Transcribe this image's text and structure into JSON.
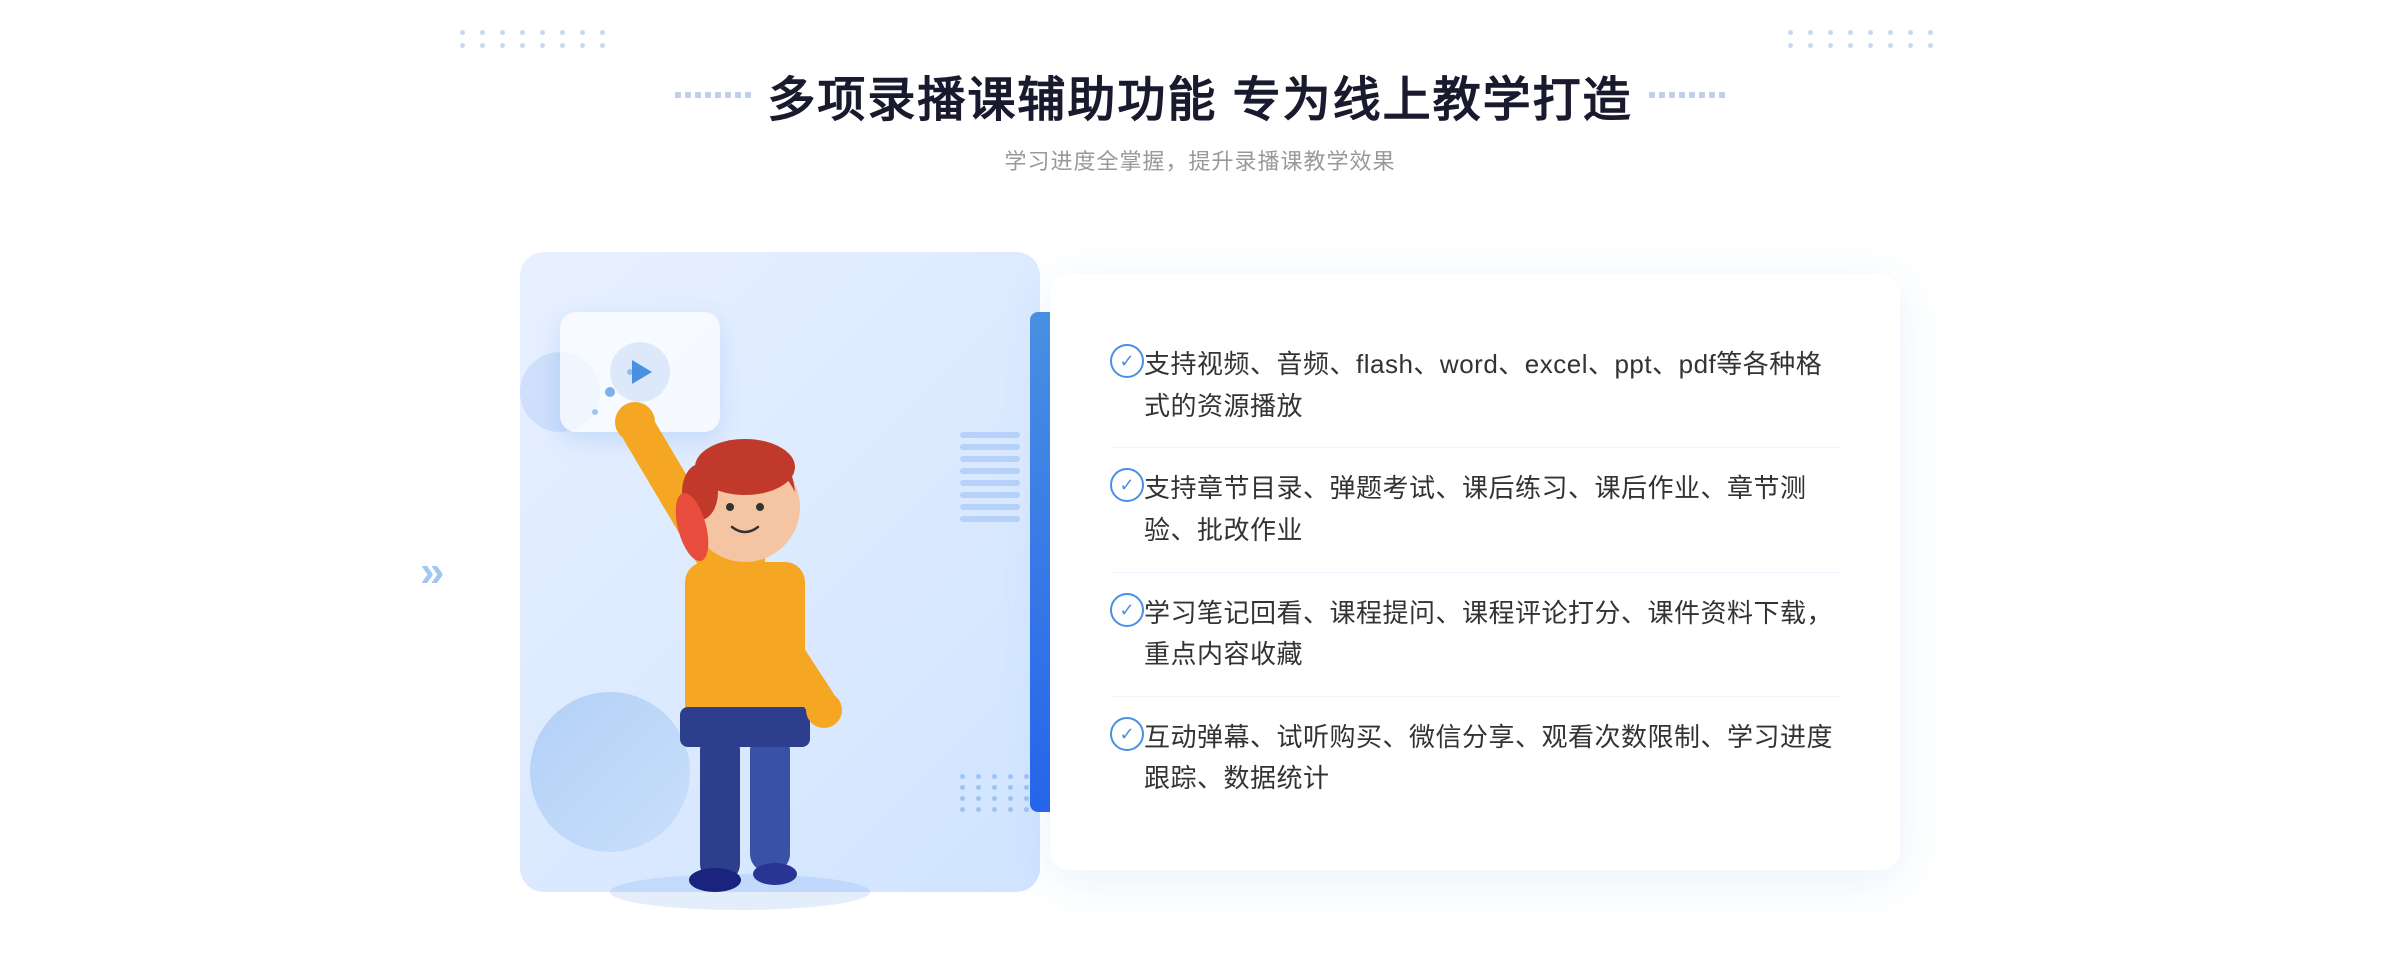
{
  "header": {
    "title": "多项录播课辅助功能 专为线上教学打造",
    "subtitle": "学习进度全掌握，提升录播课教学效果",
    "title_deco_left": "decoration-left",
    "title_deco_right": "decoration-right"
  },
  "features": [
    {
      "id": 1,
      "text": "支持视频、音频、flash、word、excel、ppt、pdf等各种格式的资源播放"
    },
    {
      "id": 2,
      "text": "支持章节目录、弹题考试、课后练习、课后作业、章节测验、批改作业"
    },
    {
      "id": 3,
      "text": "学习笔记回看、课程提问、课程评论打分、课件资料下载，重点内容收藏"
    },
    {
      "id": 4,
      "text": "互动弹幕、试听购买、微信分享、观看次数限制、学习进度跟踪、数据统计"
    }
  ],
  "colors": {
    "primary": "#4a90e2",
    "primary_dark": "#2563eb",
    "title_color": "#1a1a2e",
    "text_color": "#333333",
    "subtitle_color": "#999999",
    "bg_light": "#e8f0ff",
    "border_light": "#f0f4ff"
  },
  "icons": {
    "check": "✓",
    "chevron_left": "«",
    "play": "▶"
  }
}
